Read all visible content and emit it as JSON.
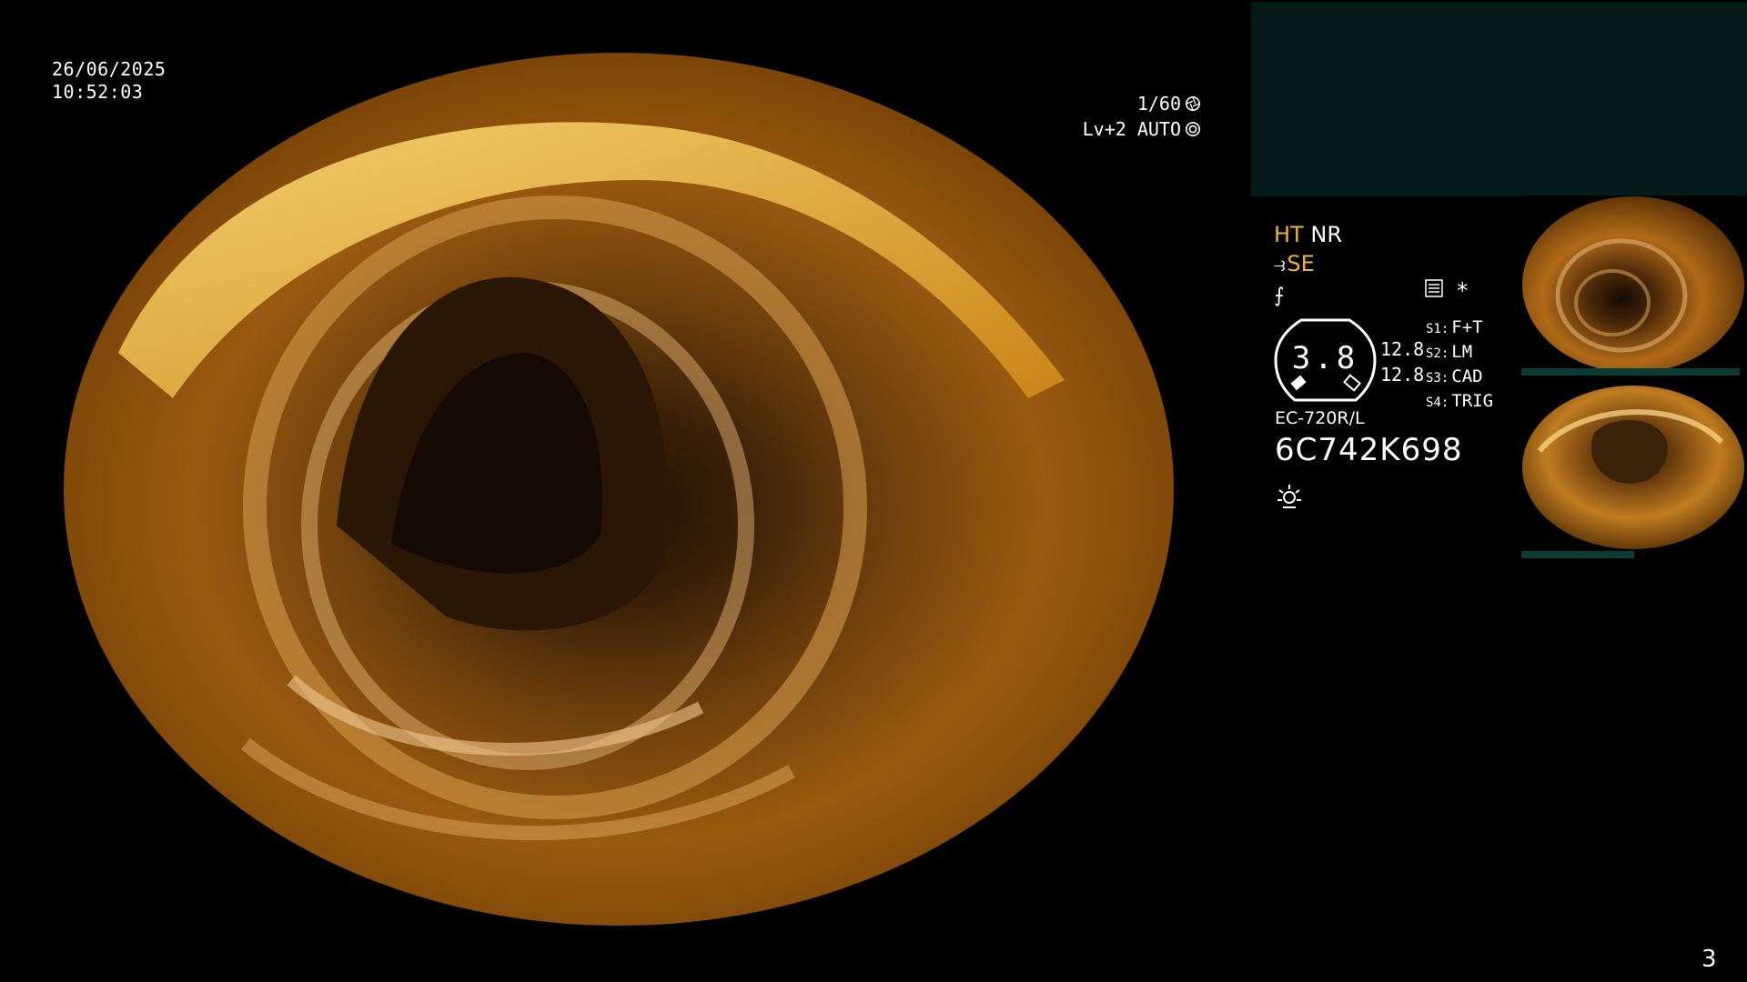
{
  "overlay": {
    "date": "26/06/2025",
    "time": "10:52:03",
    "shutter": "1/60",
    "level": "Lv+2 AUTO"
  },
  "panel": {
    "mode_ht": "HT",
    "mode_nr": "NR",
    "mode_se": "SE",
    "gauge_value": "3.8",
    "nums": [
      "12.8",
      "12.8"
    ],
    "slots": [
      {
        "key": "S1:",
        "value": "F+T"
      },
      {
        "key": "S2:",
        "value": "LM"
      },
      {
        "key": "S3:",
        "value": "CAD"
      },
      {
        "key": "S4:",
        "value": "TRIG"
      }
    ],
    "scope_model": "EC-720R/L",
    "serial": "6C742K698",
    "star": "*"
  },
  "page_number": "3",
  "colors": {
    "accent_orange": "#f0b23a",
    "panel_bg": "#031a18"
  },
  "icons": [
    "shutter-icon",
    "auto-icon",
    "structure-icon",
    "menu-icon",
    "light-icon"
  ]
}
